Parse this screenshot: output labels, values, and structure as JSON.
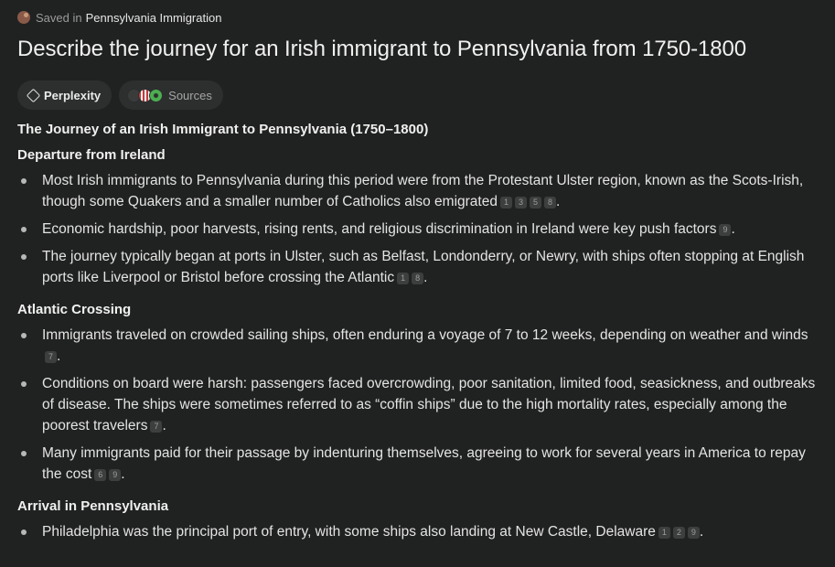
{
  "header": {
    "saved_prefix": "Saved in",
    "collection": "Pennsylvania Immigration",
    "title": "Describe the journey for an Irish immigrant to Pennsylvania from 1750-1800"
  },
  "tabs": [
    {
      "label": "Perplexity",
      "icon": "perplexity-icon"
    },
    {
      "label": "Sources",
      "icon": "sources-icon"
    }
  ],
  "answer": {
    "heading": "The Journey of an Irish Immigrant to Pennsylvania (1750–1800)",
    "sections": [
      {
        "title": "Departure from Ireland",
        "items": [
          {
            "text": "Most Irish immigrants to Pennsylvania during this period were from the Protestant Ulster region, known as the Scots-Irish, though some Quakers and a smaller number of Catholics also emigrated",
            "cites": [
              "1",
              "3",
              "5",
              "8"
            ]
          },
          {
            "text": "Economic hardship, poor harvests, rising rents, and religious discrimination in Ireland were key push factors",
            "cites": [
              "9"
            ]
          },
          {
            "text": "The journey typically began at ports in Ulster, such as Belfast, Londonderry, or Newry, with ships often stopping at English ports like Liverpool or Bristol before crossing the Atlantic",
            "cites": [
              "1",
              "8"
            ]
          }
        ]
      },
      {
        "title": "Atlantic Crossing",
        "items": [
          {
            "text": "Immigrants traveled on crowded sailing ships, often enduring a voyage of 7 to 12 weeks, depending on weather and winds",
            "cites": [
              "7"
            ]
          },
          {
            "text": "Conditions on board were harsh: passengers faced overcrowding, poor sanitation, limited food, seasickness, and outbreaks of disease. The ships were sometimes referred to as “coffin ships” due to the high mortality rates, especially among the poorest travelers",
            "cites": [
              "7"
            ]
          },
          {
            "text": "Many immigrants paid for their passage by indenturing themselves, agreeing to work for several years in America to repay the cost",
            "cites": [
              "6",
              "9"
            ]
          }
        ]
      },
      {
        "title": "Arrival in Pennsylvania",
        "items": [
          {
            "text": "Philadelphia was the principal port of entry, with some ships also landing at New Castle, Delaware",
            "cites": [
              "1",
              "2",
              "9"
            ]
          }
        ]
      }
    ]
  }
}
